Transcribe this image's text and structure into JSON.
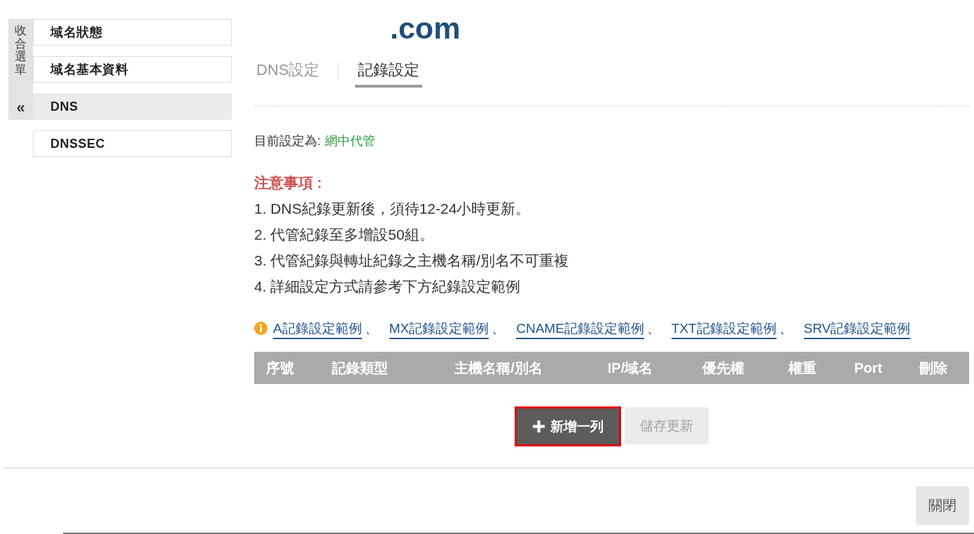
{
  "sidebar": {
    "collapse_label": "收合選單",
    "collapse_glyph": "«",
    "items": [
      {
        "label": "域名狀態",
        "selected": false
      },
      {
        "label": "域名基本資料",
        "selected": false
      },
      {
        "label": "DNS",
        "selected": true
      },
      {
        "label": "DNSSEC",
        "selected": false
      }
    ]
  },
  "title": ".com",
  "tabs": [
    {
      "label": "DNS設定",
      "selected": false
    },
    {
      "label": "記錄設定",
      "selected": true
    }
  ],
  "current_setting": {
    "label": "目前設定為:",
    "value": "網中代管"
  },
  "notice": {
    "heading": "注意事項 :",
    "items": [
      "1. DNS紀錄更新後，須待12-24小時更新。",
      "2. 代管紀錄至多增設50組。",
      "3. 代管紀錄與轉址紀錄之主機名稱/別名不可重複",
      "4. 詳細設定方式請參考下方紀錄設定範例"
    ]
  },
  "example_links": [
    {
      "label": "A記錄設定範例",
      "separator": "、"
    },
    {
      "label": "MX記錄設定範例",
      "separator": "、"
    },
    {
      "label": "CNAME記錄設定範例",
      "separator": "、"
    },
    {
      "label": "TXT記錄設定範例",
      "separator": "、"
    },
    {
      "label": "SRV記錄設定範例"
    }
  ],
  "table": {
    "columns": [
      "序號",
      "記錄類型",
      "主機名稱/別名",
      "IP/域名",
      "優先權",
      "權重",
      "Port",
      "刪除"
    ]
  },
  "buttons": [
    {
      "label": "新增一列",
      "kind": "add",
      "disabled": false,
      "highlighted": true
    },
    {
      "label": "儲存更新",
      "kind": "save",
      "disabled": true,
      "highlighted": false
    }
  ],
  "footer": {
    "close_button": "關閉"
  }
}
